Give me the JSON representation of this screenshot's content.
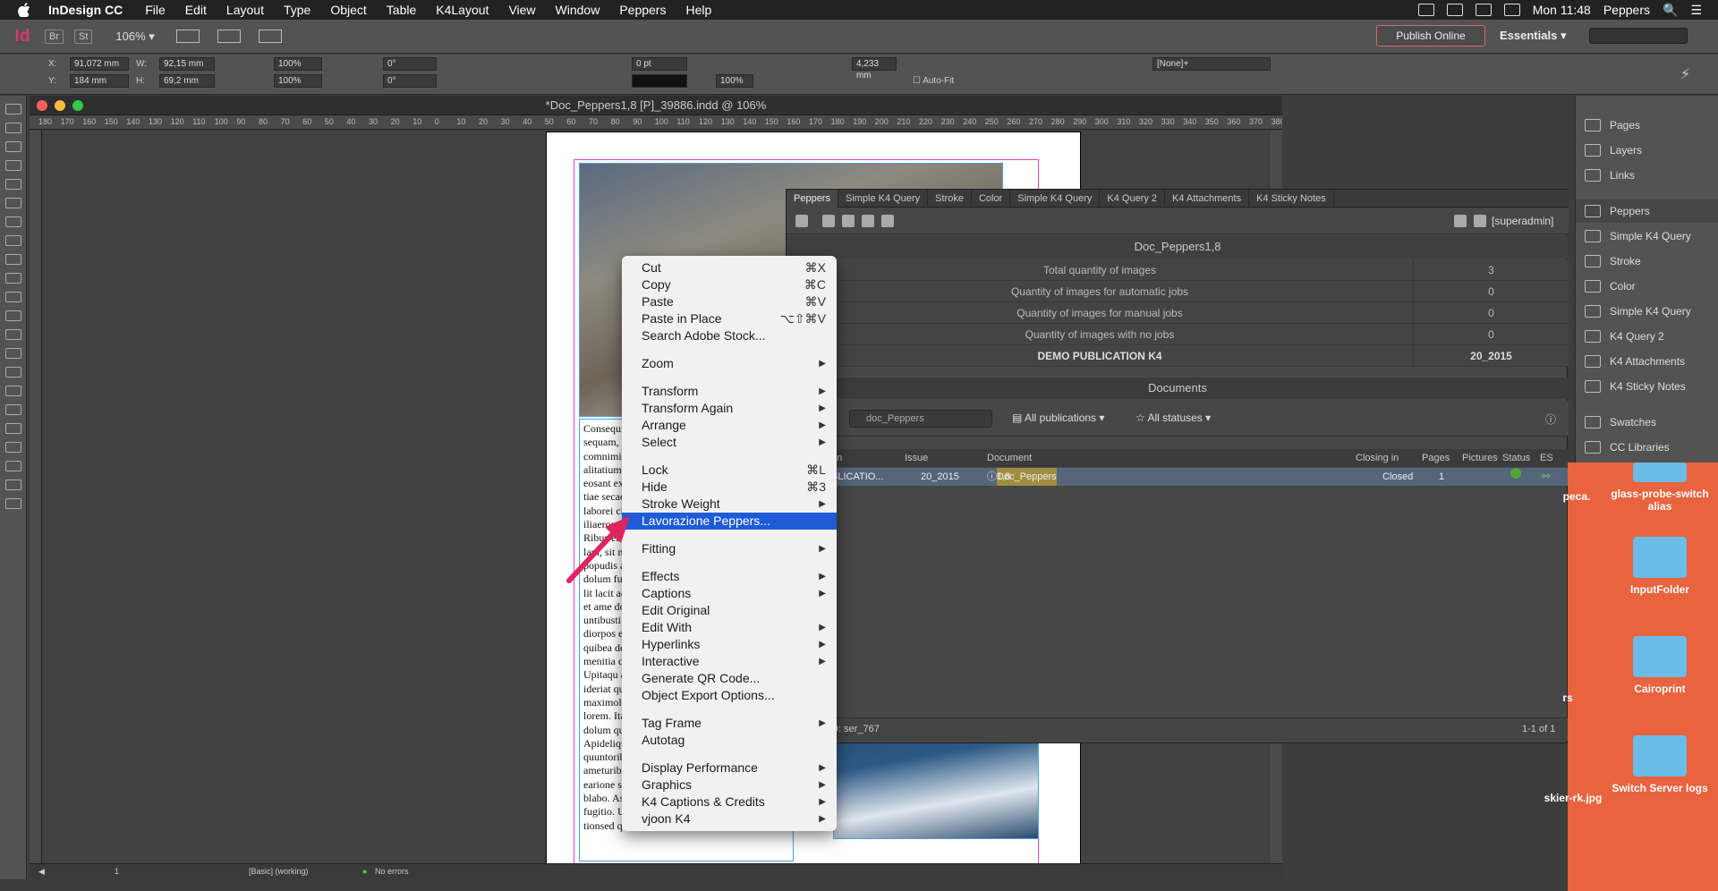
{
  "menubar": {
    "app_name": "InDesign CC",
    "items": [
      "File",
      "Edit",
      "Layout",
      "Type",
      "Object",
      "Table",
      "K4Layout",
      "View",
      "Window",
      "Peppers",
      "Help"
    ],
    "clock": "Mon 11:48",
    "user": "Peppers"
  },
  "appbar": {
    "logo": "Id",
    "bridge": "Br",
    "stock": "St",
    "zoom": "106%",
    "publish_label": "Publish Online",
    "workspace": "Essentials"
  },
  "control": {
    "x_label": "X:",
    "x_value": "91,072 mm",
    "y_label": "Y:",
    "y_value": "184 mm",
    "w_label": "W:",
    "w_value": "92,15 mm",
    "h_label": "H:",
    "h_value": "69,2 mm",
    "scale_x": "100%",
    "scale_y": "100%",
    "rotate": "0°",
    "shear": "0°",
    "stroke_pt": "0 pt",
    "opacity": "100%",
    "offset": "4,233 mm",
    "object_style": "[None]+",
    "auto_fit": "Auto-Fit"
  },
  "document": {
    "title": "*Doc_Peppers1,8 [P]_39886.indd @ 106%",
    "ruler_ticks": [
      "180",
      "170",
      "160",
      "150",
      "140",
      "130",
      "120",
      "110",
      "100",
      "90",
      "80",
      "70",
      "60",
      "50",
      "40",
      "30",
      "20",
      "10",
      "0",
      "10",
      "20",
      "30",
      "40",
      "50",
      "60",
      "70",
      "80",
      "90",
      "100",
      "110",
      "120",
      "130",
      "140",
      "150",
      "160",
      "170",
      "180",
      "190",
      "200",
      "210",
      "220",
      "230",
      "240",
      "250",
      "260",
      "270",
      "280",
      "290",
      "300",
      "310",
      "320",
      "330",
      "340",
      "350",
      "360",
      "370",
      "380"
    ],
    "body_text": "Consequi as\nsequam, off\ncomnimi, ve\nalitatium se\neosant excep\ntiae secaecl\nlaborei citat\niliaerorum\nRibus et ent\nlam, sit nqu\npopudis a\ndolum fug\nlit lacit ad et\net ame dolu\nuntibusti of\ndiorpos et a\nquibea de n\nmenitia di o\nUpitaqu ass\nideriat quan\nmaximol up\nlorem. Itae.\ndolum quat\nApideliquar\nquuntoribu\nameturibust\nearione scie\nblabo. Aspis\nfugitio. Ut u\ntionsed que",
    "status_page": "1",
    "status_preflight_profile": "[Basic] (working)",
    "status_errors": "No errors"
  },
  "peppers_panel": {
    "tabs": [
      "Peppers",
      "Simple K4 Query",
      "Stroke",
      "Color",
      "Simple K4 Query",
      "K4 Query  2",
      "K4 Attachments",
      "K4 Sticky Notes"
    ],
    "user": "[superadmin]",
    "doc_name": "Doc_Peppers1,8",
    "stats": [
      {
        "label": "Total quantity of images",
        "value": "3"
      },
      {
        "label": "Quantity of images for automatic jobs",
        "value": "0"
      },
      {
        "label": "Quantity of images for manual jobs",
        "value": "0"
      },
      {
        "label": "Quantity of images with no jobs",
        "value": "0"
      },
      {
        "label": "DEMO PUBLICATION K4",
        "value": "20_2015"
      }
    ],
    "documents_header": "Documents",
    "search_value": "doc_Peppers",
    "filter_publications": "All publications",
    "filter_statuses": "All statuses",
    "columns": [
      "on",
      "Issue",
      "Document",
      "Closing in",
      "Pages",
      "Pictures",
      "Status",
      "ES"
    ],
    "row": {
      "publication": "BLICATIO...",
      "issue": "20_2015",
      "doc_hl": "Doc_Peppers",
      "doc_rest": "1,8",
      "closing": "Closed",
      "pages": "1"
    },
    "footer_left": "D: ser_767",
    "footer_right": "1-1 of 1"
  },
  "dock": {
    "items": [
      "Pages",
      "Layers",
      "Links",
      "Peppers",
      "Simple K4 Query",
      "Stroke",
      "Color",
      "Simple K4 Query",
      "K4 Query  2",
      "K4 Attachments",
      "K4 Sticky Notes",
      "Swatches",
      "CC Libraries"
    ]
  },
  "desktop": {
    "items": [
      "peca.",
      "glass-probe-switch alias",
      "InputFolder",
      "rs",
      "Cairoprint",
      "skier-rk.jpg",
      "Switch Server logs"
    ]
  },
  "context_menu": {
    "groups": [
      [
        {
          "label": "Cut",
          "shortcut": "⌘X"
        },
        {
          "label": "Copy",
          "shortcut": "⌘C"
        },
        {
          "label": "Paste",
          "shortcut": "⌘V"
        },
        {
          "label": "Paste in Place",
          "shortcut": "⌥⇧⌘V"
        },
        {
          "label": "Search Adobe Stock...",
          "shortcut": ""
        }
      ],
      [
        {
          "label": "Zoom",
          "submenu": true
        }
      ],
      [
        {
          "label": "Transform",
          "submenu": true
        },
        {
          "label": "Transform Again",
          "submenu": true
        },
        {
          "label": "Arrange",
          "submenu": true
        },
        {
          "label": "Select",
          "submenu": true
        }
      ],
      [
        {
          "label": "Lock",
          "shortcut": "⌘L"
        },
        {
          "label": "Hide",
          "shortcut": "⌘3"
        },
        {
          "label": "Stroke Weight",
          "submenu": true
        },
        {
          "label": "Lavorazione Peppers...",
          "selected": true
        }
      ],
      [
        {
          "label": "Fitting",
          "submenu": true
        }
      ],
      [
        {
          "label": "Effects",
          "submenu": true
        },
        {
          "label": "Captions",
          "submenu": true
        },
        {
          "label": "Edit Original"
        },
        {
          "label": "Edit With",
          "submenu": true
        },
        {
          "label": "Hyperlinks",
          "submenu": true
        },
        {
          "label": "Interactive",
          "submenu": true
        },
        {
          "label": "Generate QR Code..."
        },
        {
          "label": "Object Export Options..."
        }
      ],
      [
        {
          "label": "Tag Frame",
          "submenu": true
        },
        {
          "label": "Autotag"
        }
      ],
      [
        {
          "label": "Display Performance",
          "submenu": true
        },
        {
          "label": "Graphics",
          "submenu": true
        },
        {
          "label": "K4 Captions & Credits",
          "submenu": true
        },
        {
          "label": "vjoon K4",
          "submenu": true
        }
      ]
    ]
  },
  "colors": {
    "selection": "#1e5bd8",
    "desktop": "#e8633e",
    "arrow": "#e0245e"
  }
}
